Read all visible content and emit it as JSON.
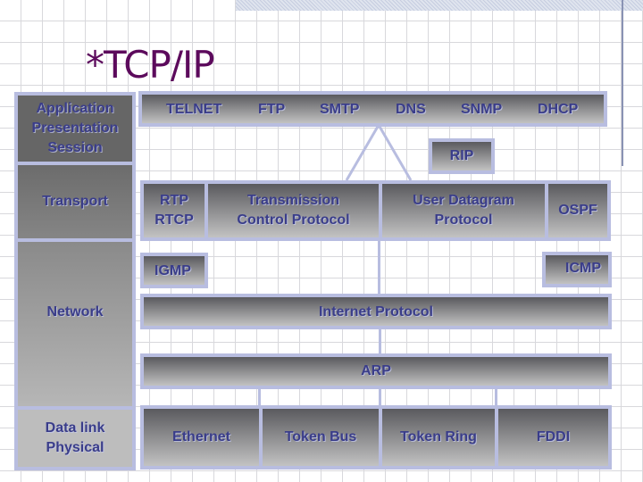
{
  "title": "*TCP/IP",
  "layers": {
    "application": [
      "Application",
      "Presentation",
      "Session"
    ],
    "transport": "Transport",
    "network": "Network",
    "datalink": [
      "Data link",
      "Physical"
    ]
  },
  "protocols": {
    "app_row": [
      "TELNET",
      "FTP",
      "SMTP",
      "DNS",
      "SNMP",
      "DHCP"
    ],
    "rip": "RIP",
    "rtp": [
      "RTP",
      "RTCP"
    ],
    "tcp": [
      "Transmission",
      "Control Protocol"
    ],
    "udp": [
      "User Datagram",
      "Protocol"
    ],
    "ospf": "OSPF",
    "igmp": "IGMP",
    "icmp": "ICMP",
    "ip": "Internet Protocol",
    "arp": "ARP",
    "link": [
      "Ethernet",
      "Token Bus",
      "Token Ring",
      "FDDI"
    ]
  }
}
